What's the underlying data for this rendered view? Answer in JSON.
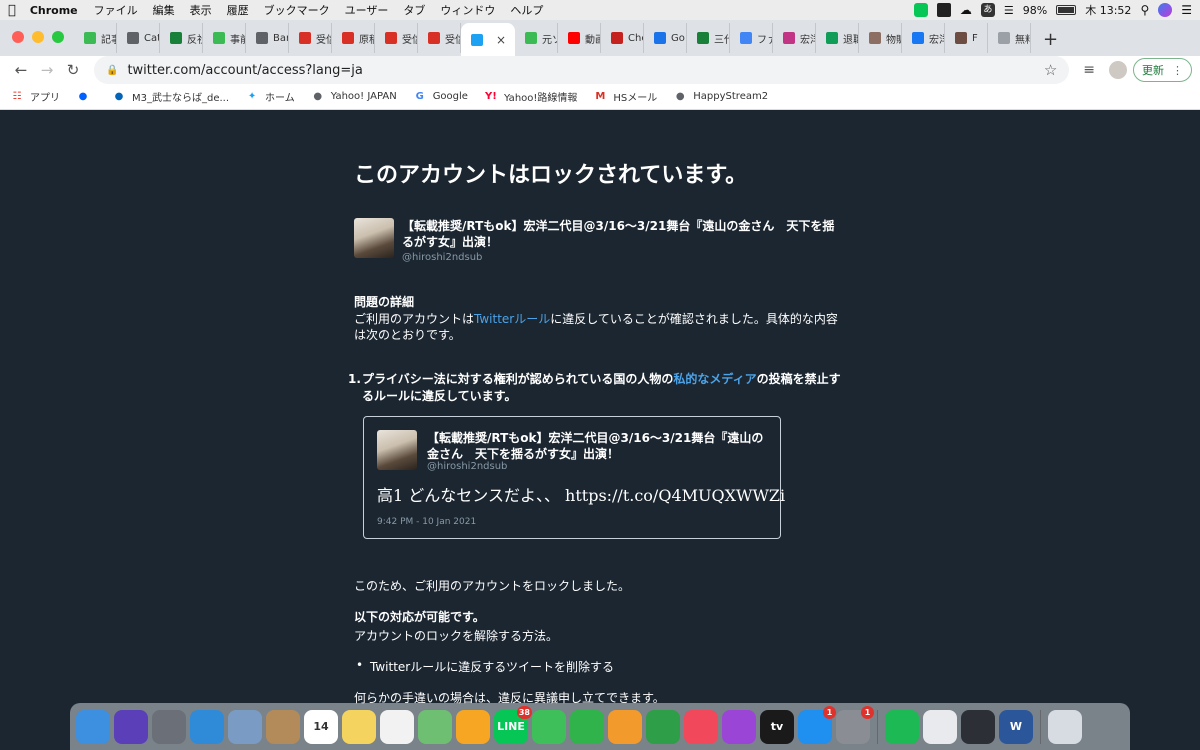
{
  "menubar": {
    "app_name": "Chrome",
    "items": [
      "ファイル",
      "編集",
      "表示",
      "履歴",
      "ブックマーク",
      "ユーザー",
      "タブ",
      "ウィンドウ",
      "ヘルプ"
    ],
    "battery": "98%",
    "clock": "木 13:52",
    "status_icons": [
      "line-icon",
      "dropbox-icon",
      "cloud-icon",
      "input-method-icon",
      "wifi-icon",
      "battery-icon",
      "search-icon",
      "siri-icon",
      "control-center-icon"
    ]
  },
  "tabs": [
    {
      "label": "記事",
      "icon": "page-icon",
      "color": "#3cba54"
    },
    {
      "label": "Cat",
      "icon": "globe-icon",
      "color": "#5f6368"
    },
    {
      "label": "反社",
      "icon": "plus-icon",
      "color": "#188038"
    },
    {
      "label": "事前",
      "icon": "page-icon",
      "color": "#3cba54"
    },
    {
      "label": "Bar",
      "icon": "globe-icon",
      "color": "#5f6368"
    },
    {
      "label": "受信",
      "icon": "gmail-icon",
      "color": "#d93025"
    },
    {
      "label": "原稿",
      "icon": "gmail-icon",
      "color": "#d93025"
    },
    {
      "label": "受信",
      "icon": "gmail-icon",
      "color": "#d93025"
    },
    {
      "label": "受信",
      "icon": "gmail-icon",
      "color": "#d93025"
    },
    {
      "label": "",
      "icon": "twitter-icon",
      "color": "#1da1f2",
      "active": true
    },
    {
      "label": "元ソ",
      "icon": "page-icon",
      "color": "#3cba54"
    },
    {
      "label": "動画",
      "icon": "youtube-icon",
      "color": "#ff0000"
    },
    {
      "label": "Che",
      "icon": "flower-icon",
      "color": "#c5221f"
    },
    {
      "label": "Go",
      "icon": "calendar-icon",
      "color": "#1a73e8"
    },
    {
      "label": "三代",
      "icon": "plus-icon",
      "color": "#188038"
    },
    {
      "label": "ファ",
      "icon": "heart-icon",
      "color": "#4285f4"
    },
    {
      "label": "宏洋",
      "icon": "instagram-icon",
      "color": "#c13584"
    },
    {
      "label": "退職",
      "icon": "doc-icon",
      "color": "#0f9d58"
    },
    {
      "label": "物販",
      "icon": "face-icon",
      "color": "#8d6e63"
    },
    {
      "label": "宏洋",
      "icon": "facebook-icon",
      "color": "#1877f2"
    },
    {
      "label": "F",
      "icon": "diamond-icon",
      "color": "#6d4c41"
    },
    {
      "label": "無料",
      "icon": "loading-icon",
      "color": "#9aa0a6"
    }
  ],
  "toolbar": {
    "url": "twitter.com/account/access?lang=ja",
    "update_label": "更新"
  },
  "bookmarks": [
    {
      "label": "アプリ",
      "icon": "apps-grid-icon",
      "color": "#ea4335"
    },
    {
      "label": "",
      "icon": "dropbox-icon",
      "color": "#0061ff"
    },
    {
      "label": "M3_武士ならば_de...",
      "icon": "onedrive-icon",
      "color": "#0364b8"
    },
    {
      "label": "ホーム",
      "icon": "twitter-icon",
      "color": "#1da1f2"
    },
    {
      "label": "Yahoo! JAPAN",
      "icon": "globe-icon",
      "color": "#5f6368"
    },
    {
      "label": "Google",
      "icon": "google-icon",
      "color": "#4285f4"
    },
    {
      "label": "Yahoo!路線情報",
      "icon": "yahoo-icon",
      "color": "#ff0033"
    },
    {
      "label": "HSメール",
      "icon": "gmail-icon",
      "color": "#d93025"
    },
    {
      "label": "HappyStream2",
      "icon": "globe-icon",
      "color": "#5f6368"
    }
  ],
  "page": {
    "heading": "このアカウントはロックされています。",
    "account": {
      "name": "【転載推奨/RTもok】宏洋二代目@3/16〜3/21舞台『遠山の金さん　天下を揺るがす女』出演！",
      "handle": "@hiroshi2ndsub"
    },
    "details_title": "問題の詳細",
    "details_before": "ご利用のアカウントは",
    "details_link": "Twitterルール",
    "details_after": "に違反していることが確認されました。具体的な内容は次のとおりです。",
    "rule_number": "1.",
    "rule_before": "プライバシー法に対する権利が認められている国の人物の",
    "rule_link": "私的なメディア",
    "rule_after": "の投稿を禁止するルールに違反しています。",
    "tweet": {
      "name": "【転載推奨/RTもok】宏洋二代目@3/16〜3/21舞台『遠山の金さん　天下を揺るがす女』出演！",
      "handle": "@hiroshi2ndsub",
      "text": "高1 どんなセンスだよ、、 https://t.co/Q4MUQXWWZi",
      "time": "9:42 PM - 10 Jan 2021"
    },
    "locked_text": "このため、ご利用のアカウントをロックしました。",
    "options_title": "以下の対応が可能です。",
    "options_body": "アカウントのロックを解除する方法。",
    "options_list": [
      "Twitterルールに違反するツイートを削除する"
    ],
    "appeal_text": "何らかの手違いの場合は、違反に異議申し立てできます。"
  },
  "dock": [
    {
      "name": "finder-icon",
      "color": "#3d8fe0"
    },
    {
      "name": "siri-icon",
      "color": "#5a3fb8"
    },
    {
      "name": "launchpad-icon",
      "color": "#6b6f78"
    },
    {
      "name": "safari-icon",
      "color": "#2f8bd8"
    },
    {
      "name": "mail-stamp-icon",
      "color": "#7a9cc4"
    },
    {
      "name": "contacts-icon",
      "color": "#b38b5a"
    },
    {
      "name": "calendar-icon",
      "color": "#ffffff",
      "label": "14"
    },
    {
      "name": "notes-icon",
      "color": "#f4d35e"
    },
    {
      "name": "reminders-icon",
      "color": "#f2f2f2"
    },
    {
      "name": "maps-icon",
      "color": "#6fbf73"
    },
    {
      "name": "photos-icon",
      "color": "#f6a623"
    },
    {
      "name": "line-icon",
      "color": "#06c755",
      "label": "LINE",
      "badge": "38"
    },
    {
      "name": "messages-icon",
      "color": "#3fbf5a"
    },
    {
      "name": "facetime-icon",
      "color": "#2fb34a"
    },
    {
      "name": "pages-icon",
      "color": "#f29b2c"
    },
    {
      "name": "numbers-icon",
      "color": "#2e9e48"
    },
    {
      "name": "music-icon",
      "color": "#f2485b"
    },
    {
      "name": "podcasts-icon",
      "color": "#9b45d6"
    },
    {
      "name": "apple-tv-icon",
      "color": "#1a1a1a",
      "label": "tv"
    },
    {
      "name": "app-store-icon",
      "color": "#1f8ff0",
      "badge": "1"
    },
    {
      "name": "system-preferences-icon",
      "color": "#8a8d93",
      "badge": "1"
    },
    {
      "name": "spotify-icon",
      "color": "#1db954"
    },
    {
      "name": "chrome-icon",
      "color": "#e8eaed"
    },
    {
      "name": "quicktime-icon",
      "color": "#2d2f36"
    },
    {
      "name": "word-icon",
      "color": "#2b579a",
      "label": "W"
    },
    {
      "name": "trash-icon",
      "color": "#d7dce2"
    }
  ]
}
